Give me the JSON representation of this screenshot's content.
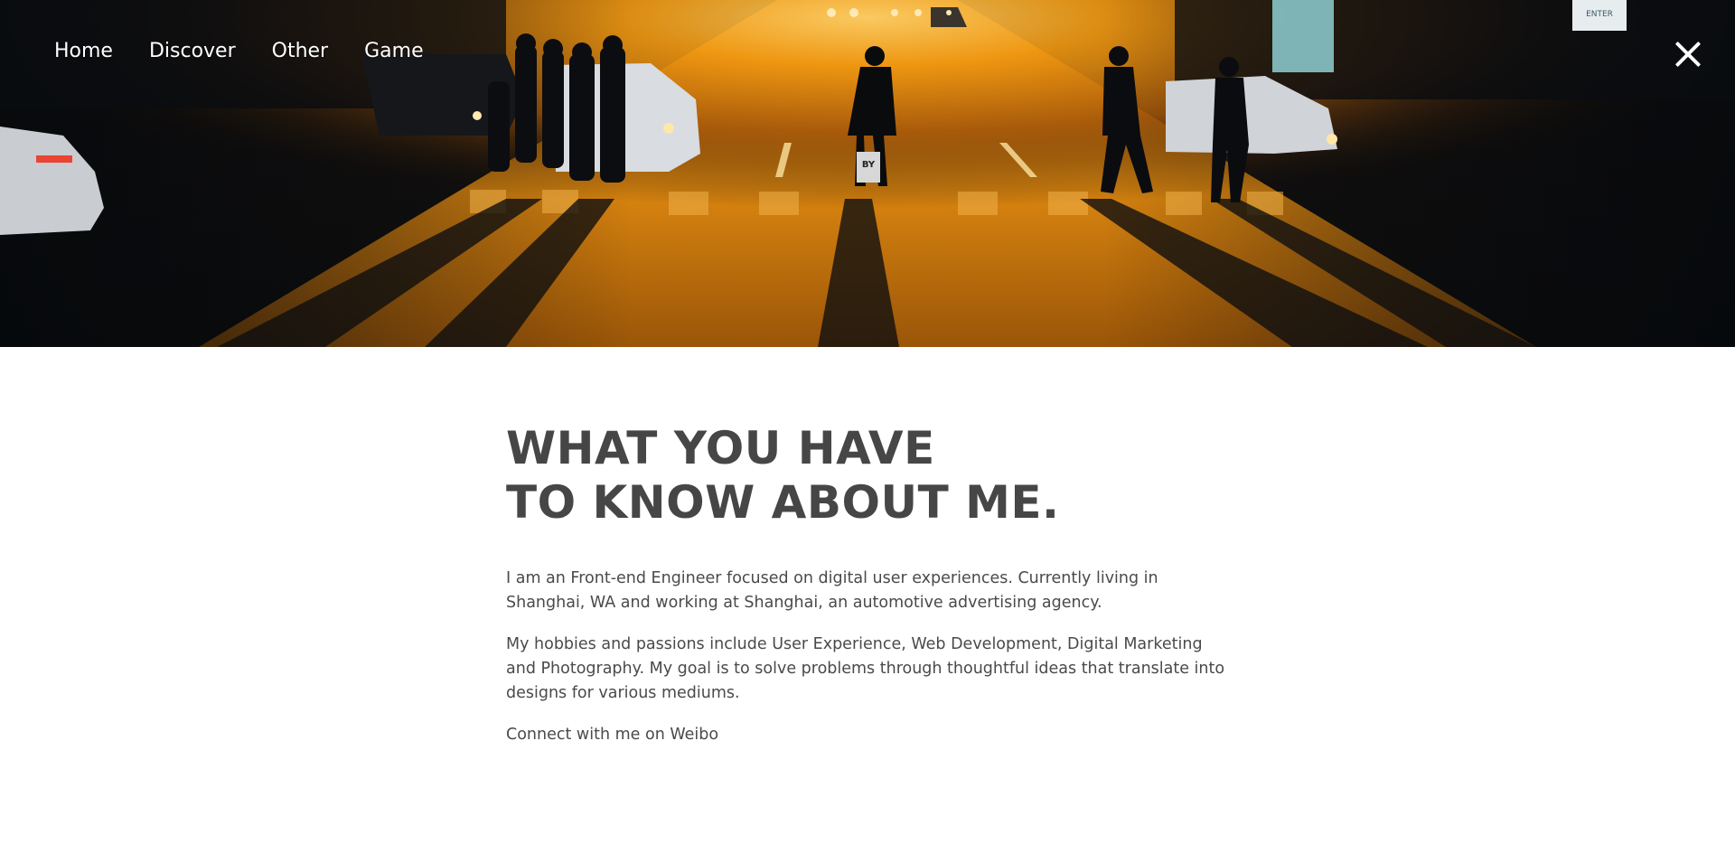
{
  "nav": {
    "items": [
      {
        "label": "Home"
      },
      {
        "label": "Discover"
      },
      {
        "label": "Other"
      },
      {
        "label": "Game"
      }
    ]
  },
  "hero": {
    "sign_text": "ENTER",
    "bag_text": "BY"
  },
  "close": {
    "icon": "close-icon"
  },
  "about": {
    "heading_line1": "WHAT YOU HAVE",
    "heading_line2": "TO KNOW ABOUT ME.",
    "paragraph1": "I am an Front-end Engineer focused on digital user experiences. Currently living in Shanghai, WA and working at Shanghai, an automotive advertising agency.",
    "paragraph2": "My hobbies and passions include User Experience, Web Development, Digital Marketing and Photography. My goal is to solve problems through thoughtful ideas that translate into designs for various mediums.",
    "connect_text": "Connect with me on Weibo"
  },
  "colors": {
    "heading": "#464646",
    "text": "#4a4a4a",
    "sun": "#f29a12"
  }
}
